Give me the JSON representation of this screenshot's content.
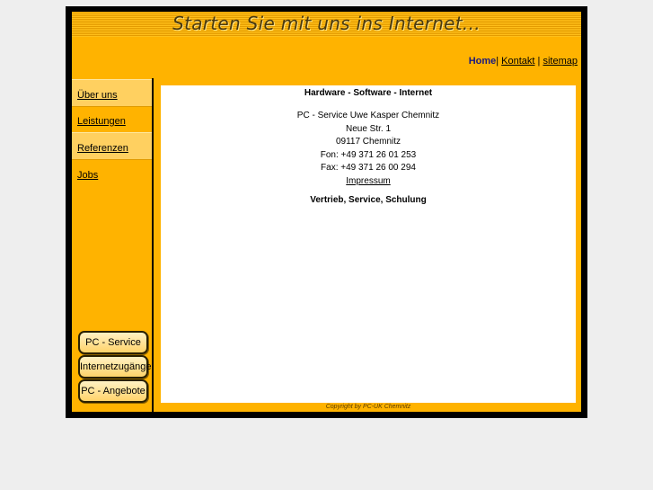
{
  "header": {
    "slogan": "Starten Sie mit uns ins Internet...",
    "nav": [
      {
        "label": "Home"
      },
      {
        "label": "Kontakt"
      },
      {
        "label": "sitemap"
      }
    ]
  },
  "sidebar": {
    "items": [
      {
        "label": "Über uns"
      },
      {
        "label": "Leistungen"
      },
      {
        "label": "Referenzen"
      },
      {
        "label": "Jobs"
      }
    ],
    "buttons": [
      {
        "label": "PC - Service"
      },
      {
        "label": "Internetzugänge"
      },
      {
        "label": "PC - Angebote"
      }
    ]
  },
  "content": {
    "heading": "Hardware - Software - Internet",
    "company": "PC - Service Uwe Kasper Chemnitz",
    "street": "Neue Str. 1",
    "city": "09117 Chemnitz",
    "phone": "Fon: +49 371 26 01 253",
    "fax": "Fax: +49 371 26 00 294",
    "impressum": "Impressum",
    "tagline": "Vertrieb, Service, Schulung"
  },
  "footer": {
    "copyright": "Copyright by PC-UK Chemnitz"
  },
  "colors": {
    "accent": "#ffb300",
    "highlight": "#ffd060",
    "frame": "#000000"
  }
}
